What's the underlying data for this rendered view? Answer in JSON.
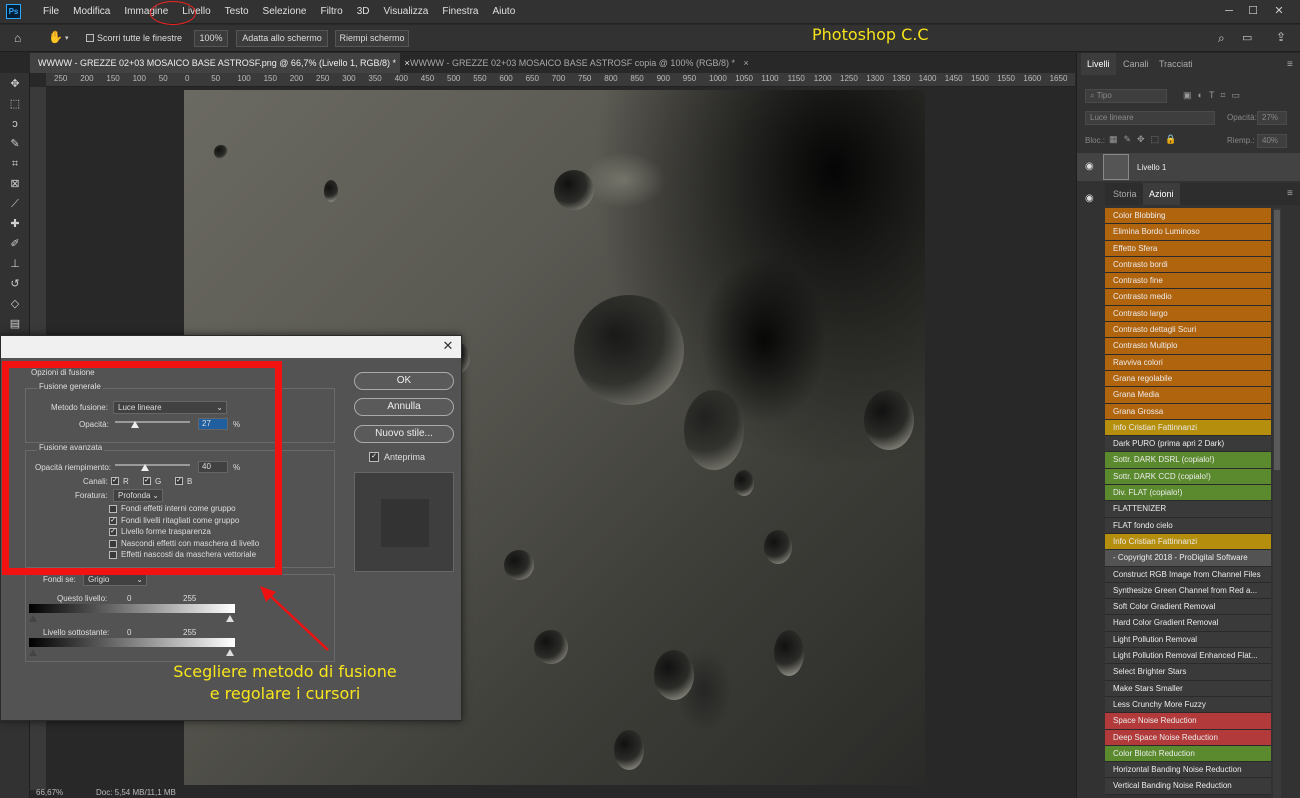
{
  "app": {
    "logo": "Ps"
  },
  "menu": [
    "File",
    "Modifica",
    "Immagine",
    "Livello",
    "Testo",
    "Selezione",
    "Filtro",
    "3D",
    "Visualizza",
    "Finestra",
    "Aiuto"
  ],
  "optbar": {
    "scroll_all": "Scorri tutte le finestre",
    "zoom": "100%",
    "fit": "Adatta allo schermo",
    "fill": "Riempi schermo"
  },
  "overlay_title": "Photoshop C.C",
  "tabs": [
    {
      "label": "WWWW - GREZZE 02+03 MOSAICO BASE ASTROSF.png @ 66,7% (Livello 1, RGB/8) *",
      "close": "×"
    },
    {
      "label": "WWWW - GREZZE 02+03 MOSAICO BASE ASTROSF copia @ 100% (RGB/8) *",
      "close": "×"
    }
  ],
  "ruler_labels": [
    "250",
    "200",
    "150",
    "100",
    "50",
    "0",
    "50",
    "100",
    "150",
    "200",
    "250",
    "300",
    "350",
    "400",
    "450",
    "500",
    "550",
    "600",
    "650",
    "700",
    "750",
    "800",
    "850",
    "900",
    "950",
    "1000",
    "1050",
    "1100",
    "1150",
    "1200",
    "1250",
    "1300",
    "1350",
    "1400",
    "1450",
    "1500",
    "1550",
    "1600",
    "1650"
  ],
  "status": {
    "zoom": "66,67%",
    "doc": "Doc: 5,54 MB/11,1 MB"
  },
  "layers_panel": {
    "tabs": [
      "Livelli",
      "Canali",
      "Tracciati"
    ],
    "kind_placeholder": "Tipo",
    "blend_mode": "Luce lineare",
    "opacity_label": "Opacità:",
    "opacity_value": "27%",
    "lock_label": "Bloc.:",
    "fill_label": "Riemp.:",
    "fill_value": "40%",
    "layer_name": "Livello 1"
  },
  "actions_panel": {
    "tabs": [
      "Storia",
      "Azioni"
    ],
    "items": [
      {
        "label": "Color Blobbing",
        "color": "orange"
      },
      {
        "label": "Elimina Bordo Luminoso",
        "color": "orange"
      },
      {
        "label": "Effetto Sfera",
        "color": "orange"
      },
      {
        "label": "Contrasto bordi",
        "color": "orange"
      },
      {
        "label": "Contrasto fine",
        "color": "orange"
      },
      {
        "label": "Contrasto medio",
        "color": "orange"
      },
      {
        "label": "Contrasto largo",
        "color": "orange"
      },
      {
        "label": "Contrasto dettagli Scuri",
        "color": "orange"
      },
      {
        "label": "Contrasto Multiplo",
        "color": "orange"
      },
      {
        "label": "Ravviva colori",
        "color": "orange"
      },
      {
        "label": "Grana regolabile",
        "color": "orange"
      },
      {
        "label": "Grana Media",
        "color": "orange"
      },
      {
        "label": "Grana Grossa",
        "color": "orange"
      },
      {
        "label": "Info Cristian Fattinnanzi",
        "color": "yellow"
      },
      {
        "label": "Dark PURO (prima apri 2 Dark)",
        "color": "dark"
      },
      {
        "label": "Sottr. DARK DSRL (copialo!)",
        "color": "green"
      },
      {
        "label": "Sottr. DARK CCD (copialo!)",
        "color": "green"
      },
      {
        "label": "Div. FLAT (copialo!)",
        "color": "green"
      },
      {
        "label": "FLATTENIZER",
        "color": "dark"
      },
      {
        "label": "FLAT fondo cielo",
        "color": "dark"
      },
      {
        "label": "Info Cristian Fattinnanzi",
        "color": "yellow"
      },
      {
        "label": "- Copyright 2018 - ProDigital Software",
        "color": "gray"
      },
      {
        "label": "Construct RGB Image from Channel Files",
        "color": "dark"
      },
      {
        "label": "Synthesize Green Channel from Red a...",
        "color": "dark"
      },
      {
        "label": "Soft Color Gradient Removal",
        "color": "dark"
      },
      {
        "label": "Hard Color Gradient Removal",
        "color": "dark"
      },
      {
        "label": "Light Pollution Removal",
        "color": "dark"
      },
      {
        "label": "Light Pollution Removal Enhanced Flat...",
        "color": "dark"
      },
      {
        "label": "Select Brighter Stars",
        "color": "dark"
      },
      {
        "label": "Make Stars Smaller",
        "color": "dark"
      },
      {
        "label": "Less Crunchy More Fuzzy",
        "color": "dark"
      },
      {
        "label": "Space Noise Reduction",
        "color": "red"
      },
      {
        "label": "Deep Space Noise Reduction",
        "color": "red"
      },
      {
        "label": "Color Blotch Reduction",
        "color": "green"
      },
      {
        "label": "Horizontal Banding Noise Reduction",
        "color": "dark"
      },
      {
        "label": "Vertical Banding Noise Reduction",
        "color": "dark"
      }
    ]
  },
  "colors": {
    "orange": "#b1640e",
    "yellow": "#b58e0d",
    "green": "#5b8a2e",
    "red": "#b23a3a",
    "gray": "#535353",
    "dark": "#3a3a3a",
    "annotation": "#f8e51c",
    "highlight": "#f21212"
  },
  "dialog": {
    "close": "✕",
    "section": "Opzioni di fusione",
    "general_group": "Fusione generale",
    "blend_label": "Metodo fusione:",
    "blend_value": "Luce lineare",
    "opacity_label": "Opacità:",
    "opacity_value": "27",
    "pct": "%",
    "advanced_group": "Fusione avanzata",
    "fill_label": "Opacità riempimento:",
    "fill_value": "40",
    "channels_label": "Canali:",
    "ch_r": "R",
    "ch_g": "G",
    "ch_b": "B",
    "knockout_label": "Foratura:",
    "knockout_value": "Profonda",
    "checkboxes": [
      {
        "label": "Fondi effetti interni come gruppo",
        "checked": false
      },
      {
        "label": "Fondi livelli ritagliati come gruppo",
        "checked": true
      },
      {
        "label": "Livello forme trasparenza",
        "checked": true
      },
      {
        "label": "Nascondi effetti con maschera di livello",
        "checked": false
      },
      {
        "label": "Effetti nascosti da maschera vettoriale",
        "checked": false
      }
    ],
    "blendif_label": "Fondi se:",
    "blendif_value": "Grigio",
    "this_layer": "Questo livello:",
    "underlying": "Livello sottostante:",
    "range_min": "0",
    "range_max": "255",
    "ok": "OK",
    "cancel": "Annulla",
    "new_style": "Nuovo stile...",
    "preview": "Anteprima"
  },
  "annotation": {
    "line1": "Scegliere metodo di fusione",
    "line2": "e regolare i cursori"
  }
}
